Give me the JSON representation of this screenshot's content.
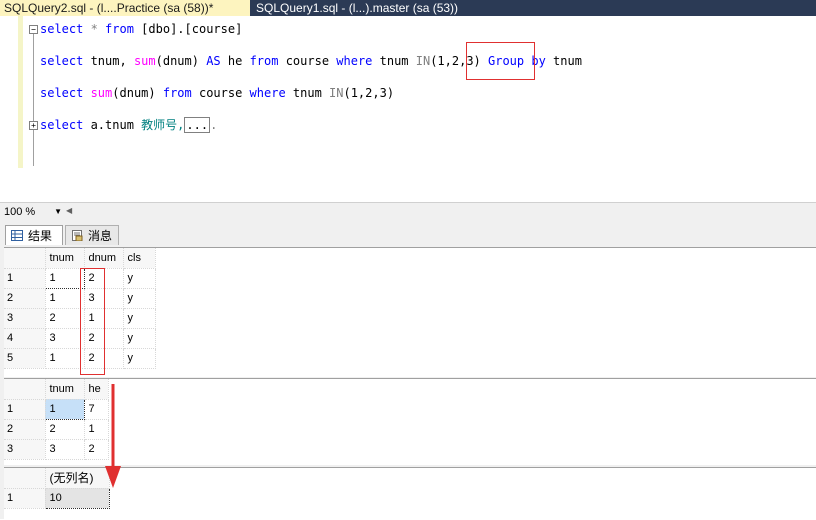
{
  "tabs": [
    {
      "label": "SQLQuery2.sql - (l....Practice (sa (58))*",
      "active": true
    },
    {
      "label": "SQLQuery1.sql - (l...).master (sa (53))",
      "active": false
    }
  ],
  "editor": {
    "line1": {
      "kw1": "select",
      "rest": " * ",
      "kw2": "from",
      "rest2": " [dbo].[course]"
    },
    "line2": {
      "kw1": "select",
      "a": " tnum, ",
      "fn": "sum",
      "b": "(dnum) ",
      "kw2": "AS",
      "c": " he ",
      "kw3": "from",
      "d": " course ",
      "kw4": "where",
      "e": " tnum ",
      "kw5": "IN",
      "f": "(1,2,3) ",
      "kw6": "Group by",
      "g": " tnum"
    },
    "line3": {
      "kw1": "select",
      "fn": " sum",
      "a": "(dnum) ",
      "kw2": "from",
      "b": " course ",
      "kw3": "where",
      "c": " tnum ",
      "kw4": "IN",
      "d": "(1,2,3)"
    },
    "line4": {
      "kw1": "select",
      "a": " a.tnum ",
      "txt": "教师号,",
      "ellipsis": "...",
      "end": "."
    }
  },
  "zoom": {
    "value": "100 %"
  },
  "result_tabs": [
    {
      "label": "结果",
      "icon": "grid-icon",
      "active": true
    },
    {
      "label": "消息",
      "icon": "message-icon",
      "active": false
    }
  ],
  "grid1": {
    "columns": [
      "tnum",
      "dnum",
      "cls"
    ],
    "rows": [
      {
        "n": "1",
        "cells": [
          "1",
          "2",
          "y"
        ]
      },
      {
        "n": "2",
        "cells": [
          "1",
          "3",
          "y"
        ]
      },
      {
        "n": "3",
        "cells": [
          "2",
          "1",
          "y"
        ]
      },
      {
        "n": "4",
        "cells": [
          "3",
          "2",
          "y"
        ]
      },
      {
        "n": "5",
        "cells": [
          "1",
          "2",
          "y"
        ]
      }
    ]
  },
  "grid2": {
    "columns": [
      "tnum",
      "he"
    ],
    "rows": [
      {
        "n": "1",
        "cells": [
          "1",
          "7"
        ]
      },
      {
        "n": "2",
        "cells": [
          "2",
          "1"
        ]
      },
      {
        "n": "3",
        "cells": [
          "3",
          "2"
        ]
      }
    ]
  },
  "grid3": {
    "columns": [
      "(无列名)"
    ],
    "rows": [
      {
        "n": "1",
        "cells": [
          "10"
        ]
      }
    ]
  },
  "colors": {
    "annotation": "#e03030",
    "keyword": "#0000ff",
    "function": "#ff00ff",
    "tab_active": "#fdf4bf",
    "tab_bar": "#2b3a55"
  }
}
